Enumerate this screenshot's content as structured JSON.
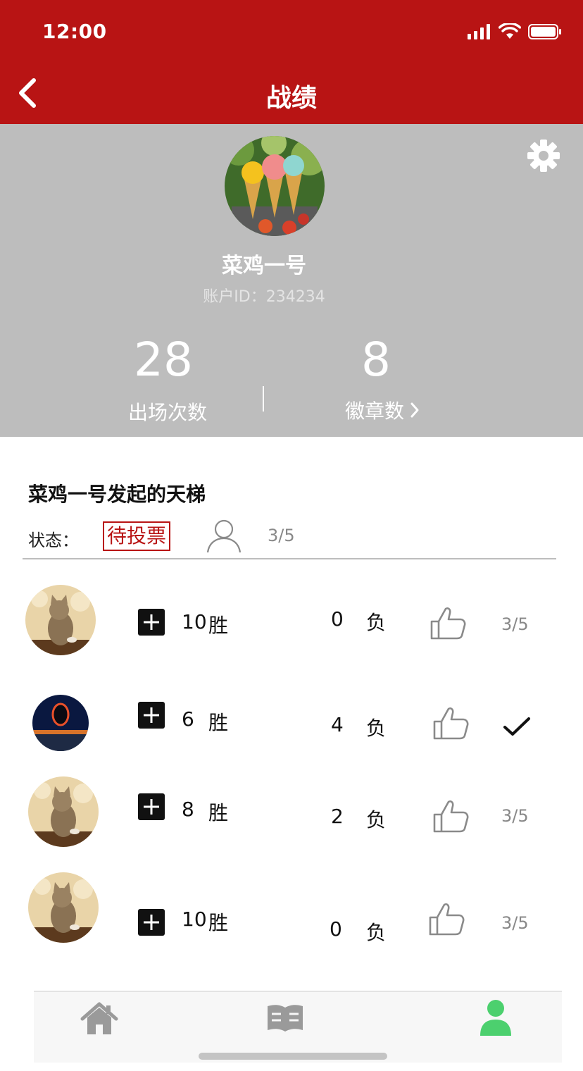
{
  "status_bar": {
    "time": "12:00"
  },
  "nav": {
    "title": "战绩"
  },
  "profile": {
    "username": "菜鸡一号",
    "account_id": "账户ID：234234",
    "appearances": {
      "value": "28",
      "label": "出场次数"
    },
    "badges": {
      "value": "8",
      "label": "徽章数"
    }
  },
  "ladder": {
    "title": "菜鸡一号发起的天梯",
    "status_label": "状态：",
    "status_value": "待投票",
    "vote_count": "3/5"
  },
  "players": [
    {
      "wins": "10",
      "win_label": "胜",
      "losses": "0",
      "loss_label": "负",
      "progress": "3/5",
      "voted": false
    },
    {
      "wins": "6",
      "win_label": "胜",
      "losses": "4",
      "loss_label": "负",
      "progress": "",
      "voted": true
    },
    {
      "wins": "8",
      "win_label": "胜",
      "losses": "2",
      "loss_label": "负",
      "progress": "3/5",
      "voted": false
    },
    {
      "wins": "10",
      "win_label": "胜",
      "losses": "0",
      "loss_label": "负",
      "progress": "3/5",
      "voted": false
    }
  ],
  "tabbar": {
    "active": "profile"
  },
  "colors": {
    "brand_red": "#b81414",
    "active_tab_green": "#4cd06e"
  }
}
